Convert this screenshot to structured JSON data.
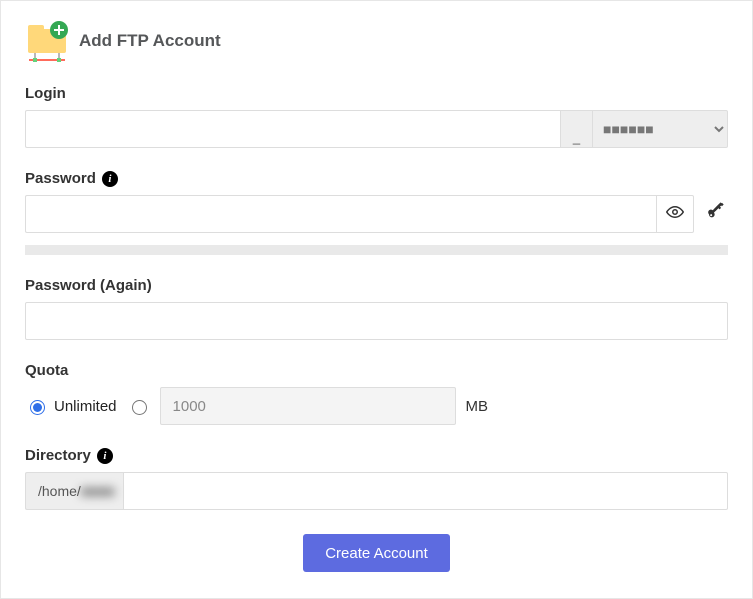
{
  "title": "Add FTP Account",
  "labels": {
    "login": "Login",
    "password": "Password",
    "password_again": "Password (Again)",
    "quota": "Quota",
    "directory": "Directory"
  },
  "login": {
    "value": "",
    "separator": "_",
    "domain_selected": "■■■■■■"
  },
  "password": {
    "value": "",
    "again": ""
  },
  "quota": {
    "unlimited_label": "Unlimited",
    "selected": "unlimited",
    "custom_value": "1000",
    "unit": "MB"
  },
  "directory": {
    "prefix_visible": "/home/",
    "prefix_obscured": "■■■■",
    "value": ""
  },
  "submit_label": "Create Account",
  "colors": {
    "primary": "#5d6be0",
    "folder": "#ffd87a",
    "plus_badge": "#34a853"
  }
}
